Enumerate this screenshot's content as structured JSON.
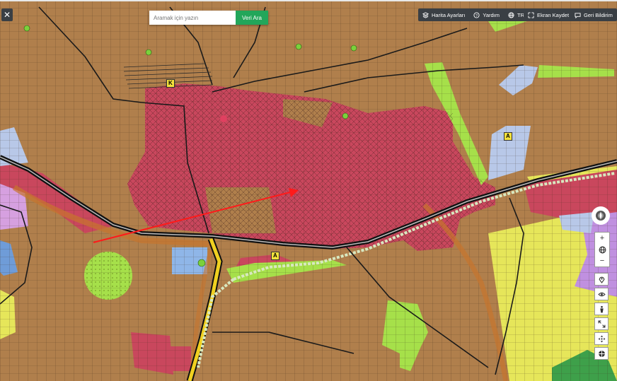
{
  "search": {
    "placeholder": "Aramak için yazın",
    "button_label": "Veri Ara"
  },
  "toolbar_left": [
    {
      "label": "Harita Ayarları",
      "icon": "layers-icon"
    },
    {
      "label": "Yardım",
      "icon": "question-icon"
    },
    {
      "label": "TR",
      "icon": "globe-icon"
    }
  ],
  "toolbar_right": [
    {
      "label": "Ekran Kaydet",
      "icon": "screen-capture-icon"
    },
    {
      "label": "Geri Bildirim",
      "icon": "feedback-icon"
    }
  ],
  "close_label": "✕",
  "map_labels": {
    "k": "K",
    "a1": "A",
    "a2": "A"
  },
  "zoom": {
    "in": "+",
    "out": "−"
  },
  "colors": {
    "residential": "#b07f4c",
    "urban_core": "#c9475d",
    "park_green": "#a6e04a",
    "yellow_zone": "#e6e65a",
    "lilac": "#c090e0",
    "light_blue": "#b8c8e8",
    "road_black": "#1a1a1a",
    "railway": "#f0d020",
    "annotation_arrow": "#ff1a1a"
  }
}
